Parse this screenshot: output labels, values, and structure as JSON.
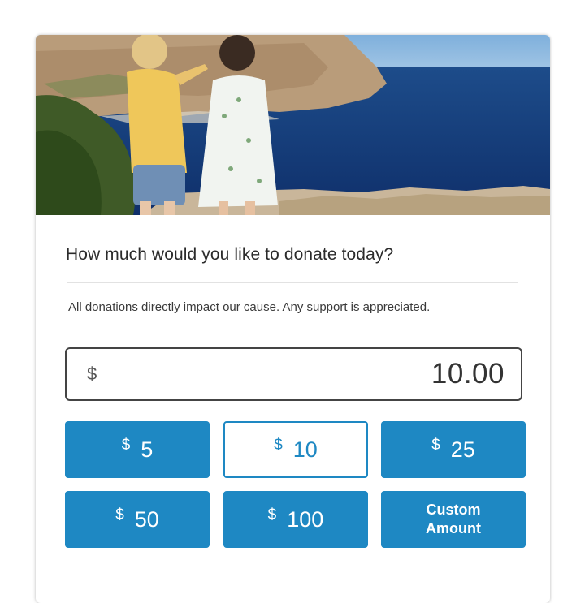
{
  "hero": {
    "image": "children-by-the-sea-photo"
  },
  "form": {
    "question": "How much would you like to donate today?",
    "subtext": "All donations directly impact our cause. Any support is appreciated.",
    "amount": {
      "currency": "$",
      "value": "10.00"
    },
    "presets": [
      {
        "currency": "$",
        "value": "5",
        "selected": false
      },
      {
        "currency": "$",
        "value": "10",
        "selected": true
      },
      {
        "currency": "$",
        "value": "25",
        "selected": false
      },
      {
        "currency": "$",
        "value": "50",
        "selected": false
      },
      {
        "currency": "$",
        "value": "100",
        "selected": false
      }
    ],
    "custom_label": "Custom Amount"
  },
  "colors": {
    "accent": "#1e88c3",
    "text": "#2b2b2b",
    "border": "#444444"
  }
}
